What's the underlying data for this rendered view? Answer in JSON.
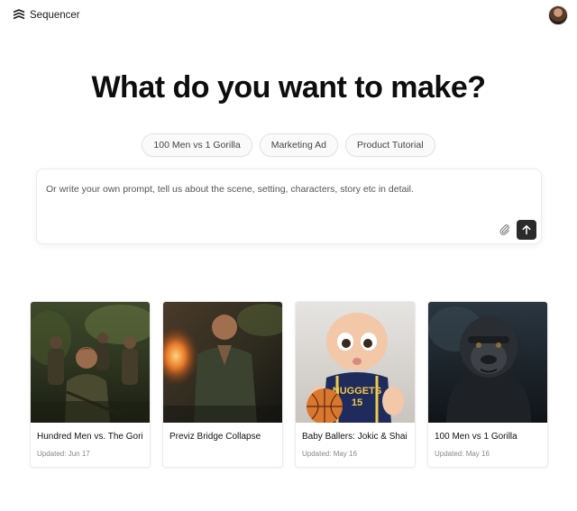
{
  "header": {
    "app_name": "Sequencer",
    "logo_icon": "layers-logo-icon",
    "avatar_icon": "user-avatar"
  },
  "main": {
    "headline": "What do you want to make?",
    "suggestions": [
      "100 Men vs 1 Gorilla",
      "Marketing Ad",
      "Product Tutorial"
    ],
    "prompt": {
      "placeholder": "Or write your own prompt, tell us about the scene, setting, characters, story etc in detail.",
      "value": "",
      "attach_icon": "paperclip-icon",
      "send_icon": "arrow-up-icon"
    }
  },
  "projects": [
    {
      "title": "Hundred Men vs. The Gori",
      "updated": "Updated: Jun 17",
      "thumb": "jungle-soldiers"
    },
    {
      "title": "Previz Bridge Collapse",
      "updated": "",
      "thumb": "man-fire-jungle"
    },
    {
      "title": "Baby Ballers: Jokic & Shai",
      "updated": "Updated: May 16",
      "thumb": "baby-basketball"
    },
    {
      "title": "100 Men vs 1 Gorilla",
      "updated": "Updated: May 16",
      "thumb": "gorilla-portrait"
    }
  ],
  "colors": {
    "send_button": "#2b2b2b",
    "chip_border": "#e3e3e3",
    "text_primary": "#0d0d0d"
  },
  "thumb_text": {
    "jersey_word": "NUGGETS",
    "jersey_number": "15"
  }
}
